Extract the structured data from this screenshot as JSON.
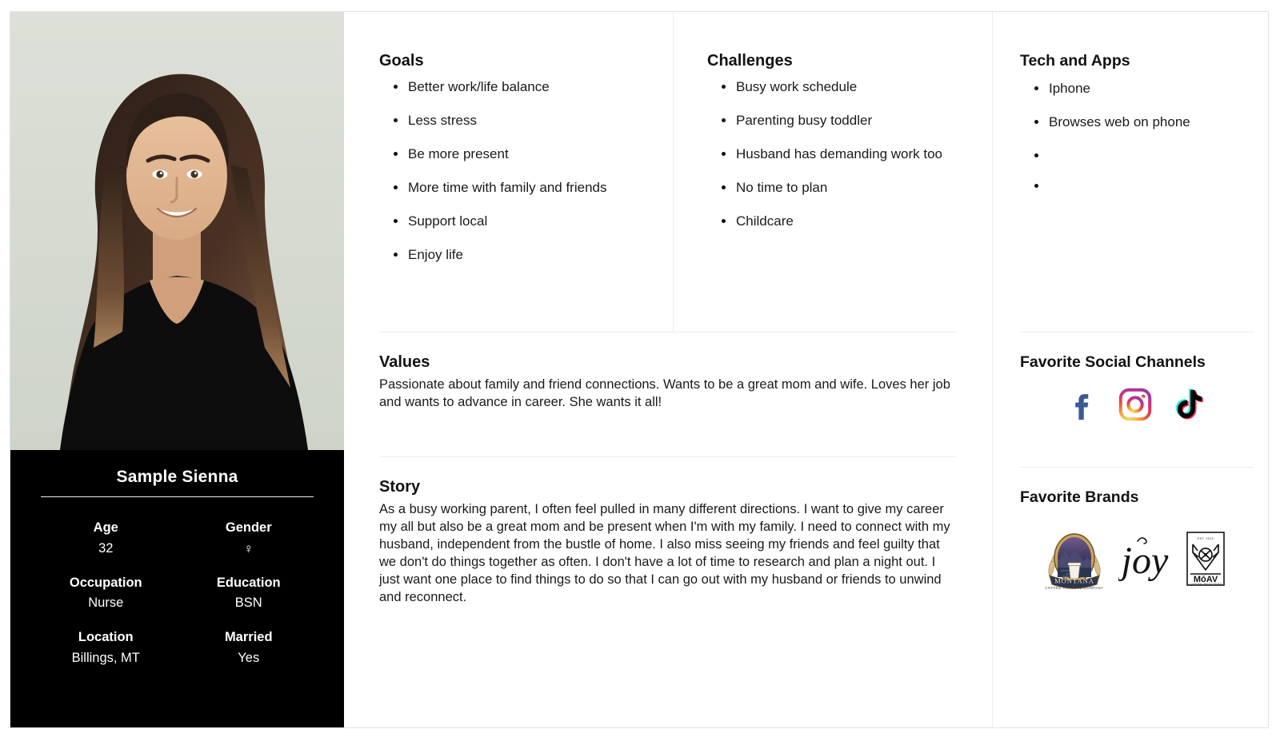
{
  "persona": {
    "name": "Sample Sienna",
    "photo_alt": "smiling-woman-portrait",
    "attributes": [
      {
        "label": "Age",
        "value": "32"
      },
      {
        "label": "Gender",
        "value": "♀"
      },
      {
        "label": "Occupation",
        "value": "Nurse"
      },
      {
        "label": "Education",
        "value": "BSN"
      },
      {
        "label": "Location",
        "value": "Billings, MT"
      },
      {
        "label": "Married",
        "value": "Yes"
      }
    ]
  },
  "goals": {
    "heading": "Goals",
    "items": [
      "Better work/life balance",
      "Less stress",
      "Be more present",
      "More time with family and friends",
      "Support local",
      "Enjoy life"
    ]
  },
  "challenges": {
    "heading": "Challenges",
    "items": [
      "Busy work schedule",
      "Parenting busy toddler",
      "Husband has demanding work too",
      "No time to plan",
      "Childcare"
    ]
  },
  "tech_and_apps": {
    "heading": "Tech and Apps",
    "items": [
      "Iphone",
      "Browses web on phone",
      "",
      ""
    ]
  },
  "values": {
    "heading": "Values",
    "text": "Passionate about family and friend connections. Wants to be a great mom and wife. Loves her job and wants to advance in career. She wants it all!"
  },
  "story": {
    "heading": "Story",
    "text": "As a busy working parent, I often feel pulled in many different directions. I want to give my career my all but also be a great mom and be present when I'm with my family. I need to connect with my husband, independent from the bustle of home. I also miss seeing my friends and feel guilty that we don't do things together as often. I don't have a lot of time to research and plan a night out. I just want one place to find things to do so that I can go out with my husband or friends to unwind and reconnect."
  },
  "social_channels": {
    "heading": "Favorite Social Channels",
    "items": [
      {
        "name": "facebook-icon",
        "color": "#3b5998"
      },
      {
        "name": "instagram-icon",
        "color": "#e1306c"
      },
      {
        "name": "tiktok-icon",
        "color": "#000000"
      }
    ]
  },
  "favorite_brands": {
    "heading": "Favorite Brands",
    "items": [
      {
        "name": "montana-coffee-traders-logo",
        "label": "MONTANA"
      },
      {
        "name": "joy-logo",
        "label": "joy"
      },
      {
        "name": "moav-coffee-roasters-logo",
        "label": "MōAV"
      }
    ]
  },
  "colors": {
    "card_border": "#e2e2e2",
    "divider": "#ececec",
    "panel_dark": "#000000",
    "text": "#1a1a1a",
    "photo_backdrop": "#d5d9d0"
  }
}
